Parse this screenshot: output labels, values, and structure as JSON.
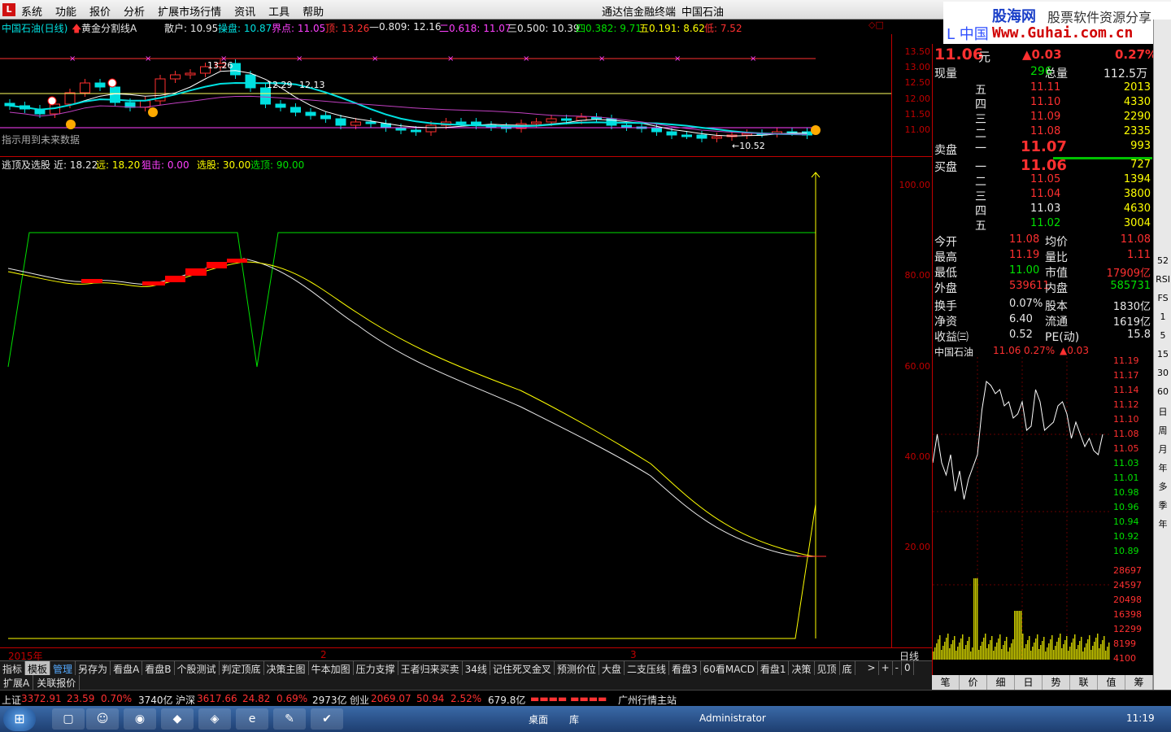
{
  "menu": {
    "logo": "L",
    "items": [
      "系统",
      "功能",
      "报价",
      "分析",
      "扩展市场行情",
      "资讯",
      "工具",
      "帮助"
    ],
    "center_title": "通达信金融终端",
    "center_stock": "中国石油"
  },
  "brand": {
    "line1": "股海网",
    "line2": "股票软件资源分享",
    "line3": "Www.Guhai.com.cn",
    "stock_prefix": "L 中国"
  },
  "window_ctl": "◇□",
  "main_header": {
    "stock": "中国石油(日线)",
    "indicator": "黄金分割线A",
    "sanhu": "散户: 10.95",
    "caopan": "操盘: 10.87",
    "jiedian": "界点: 11.05",
    "ding": "顶: 13.26",
    "l1": "—0.809: 12.16",
    "l2": "二0.618: 11.07",
    "l3": "三0.500: 10.39",
    "l4": "四0.382: 9.71",
    "l5": "五0.191: 8.62",
    "di": "低: 7.52"
  },
  "main_notes": {
    "future": "指示用到未来数据",
    "high": "13.26",
    "mid1": "12.29",
    "mid2": "12.13",
    "low": "←10.52"
  },
  "price_axis": [
    "13.50",
    "13.00",
    "12.50",
    "12.00",
    "11.50",
    "11.00"
  ],
  "ind_header": {
    "name": "逃顶及选股",
    "jin": "近: 18.22",
    "yuan": "远: 18.20",
    "juji": "狙击: 0.00",
    "xuangu": "选股: 30.00",
    "taoding": "选顶: 90.00"
  },
  "ind_axis": [
    "100.00",
    "80.00",
    "60.00",
    "40.00",
    "20.00"
  ],
  "dates": {
    "y": "2015年",
    "m2": "2",
    "m3": "3",
    "period": "日线"
  },
  "tabs": [
    "指标",
    "模板",
    "管理",
    "另存为",
    "看盘A",
    "看盘B",
    "个股测试",
    "判定顶底",
    "决策主图",
    "牛本加图",
    "压力支撑",
    "王者归来买卖",
    "34线",
    "记住死叉金叉",
    "预测价位",
    "大盘",
    "二支压线",
    "看盘3",
    "60看MACD",
    "看盘1",
    "决策",
    "见顶",
    "底"
  ],
  "tab_nav": [
    ">",
    "+",
    "-",
    "0"
  ],
  "tabs2": [
    "扩展A",
    "关联报价"
  ],
  "quote": {
    "price": "11.06",
    "unit": "元",
    "change": "▲0.03",
    "pct": "0.27%",
    "xianliang_label": "现量",
    "xianliang": "296",
    "zongliang_label": "总量",
    "zongliang": "112.5万",
    "sell_label": "卖盘",
    "buy_label": "买盘",
    "sells": [
      {
        "l": "五",
        "p": "11.11",
        "v": "2013"
      },
      {
        "l": "四",
        "p": "11.10",
        "v": "4330"
      },
      {
        "l": "三",
        "p": "11.09",
        "v": "2290"
      },
      {
        "l": "二",
        "p": "11.08",
        "v": "2335"
      },
      {
        "l": "一",
        "p": "11.07",
        "v": "993"
      }
    ],
    "buys": [
      {
        "l": "一",
        "p": "11.06",
        "v": "727"
      },
      {
        "l": "二",
        "p": "11.05",
        "v": "1394"
      },
      {
        "l": "三",
        "p": "11.04",
        "v": "3800"
      },
      {
        "l": "四",
        "p": "11.03",
        "v": "4630"
      },
      {
        "l": "五",
        "p": "11.02",
        "v": "3004"
      }
    ],
    "stats": [
      [
        "今开",
        "11.08",
        "均价",
        "11.08"
      ],
      [
        "最高",
        "11.19",
        "量比",
        "1.11"
      ],
      [
        "最低",
        "11.00",
        "市值",
        "17909亿"
      ],
      [
        "外盘",
        "539611",
        "内盘",
        "585731"
      ]
    ],
    "stats2": [
      [
        "换手",
        "0.07%",
        "股本",
        "1830亿"
      ],
      [
        "净资",
        "6.40",
        "流通",
        "1619亿"
      ],
      [
        "收益㈢",
        "0.52",
        "PE(动)",
        "15.8"
      ]
    ]
  },
  "mini": {
    "title": "中国石油",
    "price": "11.06",
    "pct": "0.27%",
    "chg": "▲0.03",
    "axis": [
      "11.19",
      "11.17",
      "11.14",
      "11.12",
      "11.10",
      "11.08",
      "11.05",
      "11.03",
      "11.01",
      "10.98",
      "10.96",
      "10.94",
      "10.92",
      "10.89"
    ],
    "vol_axis": [
      "28697",
      "24597",
      "20498",
      "16398",
      "12299",
      "8199",
      "4100"
    ]
  },
  "rbottom": [
    "笔",
    "价",
    "细",
    "日",
    "势",
    "联",
    "值",
    "筹"
  ],
  "rside": [
    "52",
    "RSI",
    "FS",
    "1",
    "5",
    "15",
    "30",
    "60",
    "日",
    "周",
    "月",
    "年",
    "多",
    "季",
    "年"
  ],
  "status": {
    "sh_label": "上证",
    "sh": "3372.91",
    "sh_chg": "23.59",
    "sh_pct": "0.70%",
    "sh_amt": "3740亿",
    "hs_label": "沪深",
    "hs": "3617.66",
    "hs_chg": "24.82",
    "hs_pct": "0.69%",
    "hs_amt": "2973亿",
    "cy_label": "创业",
    "cy": "2069.07",
    "cy_chg": "50.94",
    "cy_pct": "2.52%",
    "cy_amt": "679.8亿",
    "site": "广州行情主站"
  },
  "taskbar": {
    "desktop": "桌面",
    "lib": "库",
    "user": "Administrator",
    "time": "11:19"
  },
  "colors": {
    "up": "#ff3030",
    "down": "#00e0e0",
    "ma1": "#ffffff",
    "ma2": "#00e0e0",
    "ma3": "#c040c0",
    "yellow": "#ffff00",
    "green": "#00e000"
  }
}
